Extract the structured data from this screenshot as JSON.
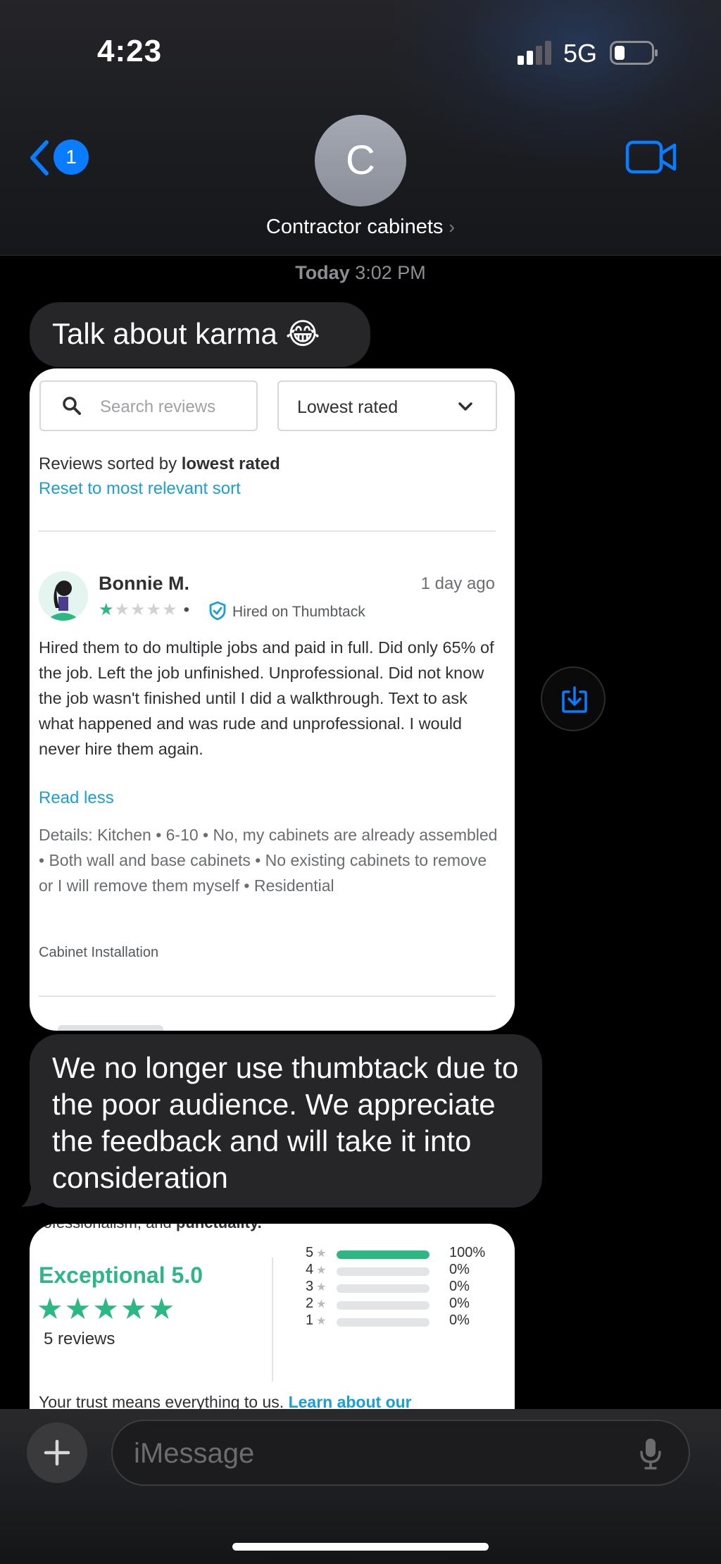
{
  "status_bar": {
    "time": "4:23",
    "network": "5G"
  },
  "header": {
    "back_badge": "1",
    "avatar_initial": "C",
    "contact_name": "Contractor cabinets",
    "accent_color": "#0a7cff"
  },
  "thread": {
    "timestamp_day": "Today",
    "timestamp_time": "3:02 PM",
    "message_1": "Talk about karma 😂",
    "message_2": "We no longer use thumbtack due to the poor audience. We appreciate the feedback and will take it into consideration"
  },
  "screenshot_1": {
    "search_placeholder": "Search reviews",
    "sort_value": "Lowest rated",
    "sorted_prefix": "Reviews sorted by ",
    "sorted_bold": "lowest rated",
    "reset_link": "Reset to most relevant sort",
    "review": {
      "name": "Bonnie M.",
      "when": "1 day ago",
      "rating": 1,
      "rating_max": 5,
      "hired_label": "Hired on Thumbtack",
      "body": "Hired them to do multiple jobs and paid in full. Did only 65% of the job. Left the job unfinished. Unprofessional. Did not know the job wasn't finished until I did a walkthrough. Text to ask what happened and was rude and unprofessional. I would never hire them again.",
      "read_less": "Read less",
      "details": "Details: Kitchen • 6-10 • No, my cabinets are already assembled • Both wall and base cabinets • No existing cabinets to remove or I will remove them myself • Residential",
      "category": "Cabinet Installation"
    }
  },
  "screenshot_2": {
    "cut_text_prefix": "professionalism, and ",
    "cut_text_bold": "punctuality.",
    "rating_label": "Exceptional 5.0",
    "stars": "★★★★★",
    "review_count": "5 reviews",
    "distribution": [
      {
        "stars": "5",
        "percent": 100,
        "label": "100%"
      },
      {
        "stars": "4",
        "percent": 0,
        "label": "0%"
      },
      {
        "stars": "3",
        "percent": 0,
        "label": "0%"
      },
      {
        "stars": "2",
        "percent": 0,
        "label": "0%"
      },
      {
        "stars": "1",
        "percent": 0,
        "label": "0%"
      }
    ],
    "trust_text": "Your trust means everything to us. ",
    "trust_link": "Learn about our"
  },
  "composer": {
    "placeholder": "iMessage"
  },
  "icons": [
    "back-chevron-icon",
    "video-camera-icon",
    "search-icon",
    "chevron-down-icon",
    "verified-shield-icon",
    "save-download-icon",
    "plus-icon",
    "microphone-icon"
  ]
}
